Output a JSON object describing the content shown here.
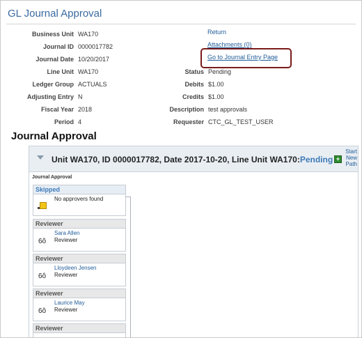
{
  "page": {
    "title": "GL Journal Approval"
  },
  "fields_left": [
    {
      "label": "Business Unit",
      "value": "WA170"
    },
    {
      "label": "Journal ID",
      "value": "0000017782"
    },
    {
      "label": "Journal Date",
      "value": "10/20/2017"
    },
    {
      "label": "Line Unit",
      "value": "WA170"
    },
    {
      "label": "Ledger Group",
      "value": "ACTUALS"
    },
    {
      "label": "Adjusting Entry",
      "value": "N"
    },
    {
      "label": "Fiscal Year",
      "value": "2018"
    },
    {
      "label": "Period",
      "value": "4"
    }
  ],
  "links": {
    "return": "Return",
    "attachments": "Attachments (0)",
    "go_to_entry": "Go to Journal Entry Page"
  },
  "fields_right": [
    {
      "label": "Status",
      "value": "Pending"
    },
    {
      "label": "Debits",
      "value": "$1.00"
    },
    {
      "label": "Credits",
      "value": "$1.00"
    },
    {
      "label": "Description",
      "value": "test approvals"
    },
    {
      "label": "Requester",
      "value": "CTC_GL_TEST_USER"
    }
  ],
  "approval": {
    "section_title": "Journal Approval",
    "header_text": "Unit WA170, ID 0000017782, Date 2017-10-20, Line Unit WA170:",
    "header_status": "Pending",
    "start_new_path": [
      "Start",
      "New",
      "Path"
    ],
    "inner_label": "Journal Approval",
    "stages": [
      {
        "title": "Skipped",
        "kind": "skipped",
        "text": "No approvers found",
        "icon": "warning-icon"
      },
      {
        "title": "Reviewer",
        "kind": "reviewer",
        "name": "Sara Allen",
        "role": "Reviewer",
        "icon": "glasses-icon"
      },
      {
        "title": "Reviewer",
        "kind": "reviewer",
        "name": "Lloydeen Jensen",
        "role": "Reviewer",
        "icon": "glasses-icon"
      },
      {
        "title": "Reviewer",
        "kind": "reviewer",
        "name": "Laurice May",
        "role": "Reviewer",
        "icon": "glasses-icon"
      },
      {
        "title": "Reviewer",
        "kind": "reviewer"
      }
    ]
  },
  "colors": {
    "title_blue": "#3a6aa0",
    "link_blue": "#1f5c99",
    "highlight_box": "#7a1a1a",
    "pending_blue": "#3d7ab8"
  }
}
